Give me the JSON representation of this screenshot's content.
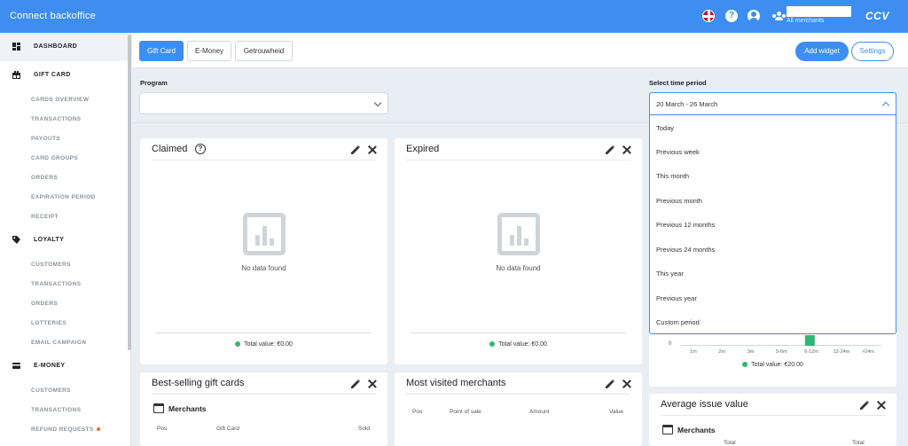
{
  "header": {
    "app_title": "Connect backoffice",
    "merchant_selector_label": "All merchants",
    "brand": "CCV",
    "help_symbol": "?"
  },
  "sidebar": {
    "sections": [
      {
        "label": "DASHBOARD",
        "icon": "dashboard-icon",
        "active": true,
        "items": []
      },
      {
        "label": "GIFT CARD",
        "icon": "gift-card-icon",
        "items": [
          "CARDS OVERVIEW",
          "TRANSACTIONS",
          "PAYOUTS",
          "CARD GROUPS",
          "ORDERS",
          "EXPIRATION PERIOD",
          "RECEIPT"
        ]
      },
      {
        "label": "LOYALTY",
        "icon": "tag-icon",
        "items": [
          "CUSTOMERS",
          "TRANSACTIONS",
          "ORDERS",
          "LOTTERIES",
          "EMAIL CAMPAIGN"
        ]
      },
      {
        "label": "E-MONEY",
        "icon": "card-icon",
        "items": [
          "CUSTOMERS",
          "TRANSACTIONS",
          "REFUND REQUESTS"
        ]
      }
    ]
  },
  "tabs": [
    {
      "label": "Gift Card",
      "active": true
    },
    {
      "label": "E-Money",
      "active": false
    },
    {
      "label": "Getrouwheid",
      "active": false
    }
  ],
  "toolbar": {
    "add_widget_label": "Add widget",
    "settings_label": "Settings"
  },
  "filters": {
    "program_label": "Program",
    "program_value": "",
    "time_period_label": "Select time period",
    "time_period_value": "20 March - 26 March",
    "time_period_options": [
      "Today",
      "Previous week",
      "This month",
      "Previous month",
      "Previous 12 months",
      "Previous 24 months",
      "This year",
      "Previous year",
      "Custom period"
    ]
  },
  "widgets": {
    "claimed": {
      "title": "Claimed",
      "help_symbol": "?",
      "empty_text": "No data found",
      "total": "Total value: €0.00"
    },
    "expired": {
      "title": "Expired",
      "empty_text": "No data found",
      "total": "Total value: €0.00"
    },
    "age_histogram": {
      "total": "Total value: €20.00",
      "y_zero": "0",
      "ticks": [
        "1m",
        "2m",
        "3m",
        "5-6m",
        "6-12m",
        "12-24m",
        ">24m"
      ]
    },
    "best_selling": {
      "title": "Best-selling gift cards",
      "section": "Merchants",
      "columns": [
        "Pos",
        "Gift Card",
        "Sold"
      ]
    },
    "most_visited": {
      "title": "Most visited merchants",
      "columns": [
        "Pos",
        "Point of sale",
        "Amount",
        "Value"
      ]
    },
    "average_issue": {
      "title": "Average issue value",
      "section": "Merchants",
      "col_total_a": "Total",
      "col_total_b": "Total"
    }
  },
  "chart_data": {
    "type": "bar",
    "categories": [
      "1m",
      "2m",
      "3m",
      "5-6m",
      "6-12m",
      "12-24m",
      ">24m"
    ],
    "series": [
      {
        "values": [
          0,
          0,
          0,
          0,
          20,
          0,
          0
        ]
      }
    ]
  },
  "colors": {
    "primary": "#3d8ef0",
    "success": "#2eb872",
    "notification": "#f26b2c"
  }
}
